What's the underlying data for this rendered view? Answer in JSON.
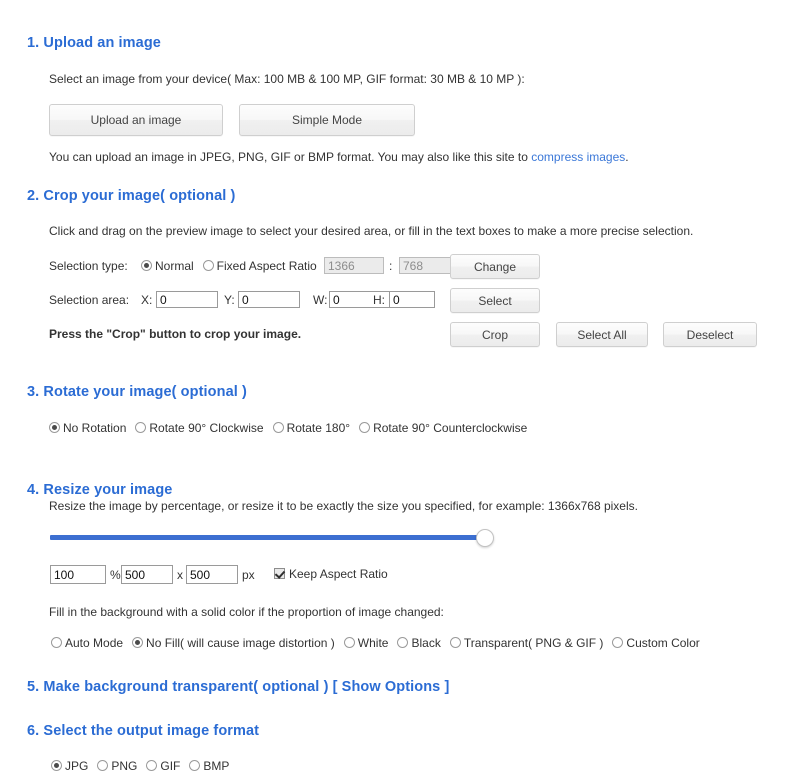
{
  "sections": {
    "upload": {
      "title": "1. Upload an image",
      "desc": "Select an image from your device( Max: 100 MB & 100 MP, GIF format: 30 MB & 10 MP ):",
      "upload_button": "Upload an image",
      "simple_mode_button": "Simple Mode",
      "note_prefix": "You can upload an image in JPEG, PNG, GIF or BMP format. You may also like this site to ",
      "note_link": "compress images",
      "note_suffix": "."
    },
    "crop": {
      "title": "2. Crop your image( optional )",
      "desc": "Click and drag on the preview image to select your desired area, or fill in the text boxes to make a more precise selection.",
      "selection_type_label": "Selection type:",
      "normal_label": "Normal",
      "fixed_ratio_label": "Fixed Aspect Ratio",
      "ratio_w": "1366",
      "ratio_sep": ":",
      "ratio_h": "768",
      "change_button": "Change",
      "selection_area_label": "Selection area:",
      "x_label": "X:",
      "x_value": "0",
      "y_label": "Y:",
      "y_value": "0",
      "w_label": "W:",
      "w_value": "0",
      "h_label": "H:",
      "h_value": "0",
      "select_button": "Select",
      "hint": "Press the \"Crop\" button to crop your image.",
      "crop_button": "Crop",
      "select_all_button": "Select All",
      "deselect_button": "Deselect"
    },
    "rotate": {
      "title": "3. Rotate your image( optional )",
      "options": [
        {
          "label": "No Rotation",
          "checked": true
        },
        {
          "label": "Rotate 90° Clockwise",
          "checked": false
        },
        {
          "label": "Rotate 180°",
          "checked": false
        },
        {
          "label": "Rotate 90° Counterclockwise",
          "checked": false
        }
      ]
    },
    "resize": {
      "title": "4. Resize your image",
      "desc": "Resize the image by percentage, or resize it to be exactly the size you specified, for example: 1366x768 pixels.",
      "slider_percent": 100,
      "percent_value": "100",
      "percent_unit": "%",
      "width_value": "500",
      "times": "x",
      "height_value": "500",
      "px_unit": "px",
      "keep_aspect_label": "Keep Aspect Ratio",
      "keep_aspect_checked": true,
      "fill_desc": "Fill in the background with a solid color if the proportion of image changed:",
      "fill_options": [
        {
          "label": "Auto Mode",
          "checked": false
        },
        {
          "label": "No Fill( will cause image distortion )",
          "checked": true
        },
        {
          "label": "White",
          "checked": false
        },
        {
          "label": "Black",
          "checked": false
        },
        {
          "label": "Transparent( PNG & GIF )",
          "checked": false
        },
        {
          "label": "Custom Color",
          "checked": false
        }
      ]
    },
    "transparent": {
      "title": "5. Make background transparent( optional ) [ Show Options ]"
    },
    "format": {
      "title": "6. Select the output image format",
      "options": [
        {
          "label": "JPG",
          "checked": true
        },
        {
          "label": "PNG",
          "checked": false
        },
        {
          "label": "GIF",
          "checked": false
        },
        {
          "label": "BMP",
          "checked": false
        }
      ]
    }
  },
  "colors": {
    "heading": "#2b6cd4",
    "link": "#3b78d8",
    "slider": "#3c6fd1"
  }
}
